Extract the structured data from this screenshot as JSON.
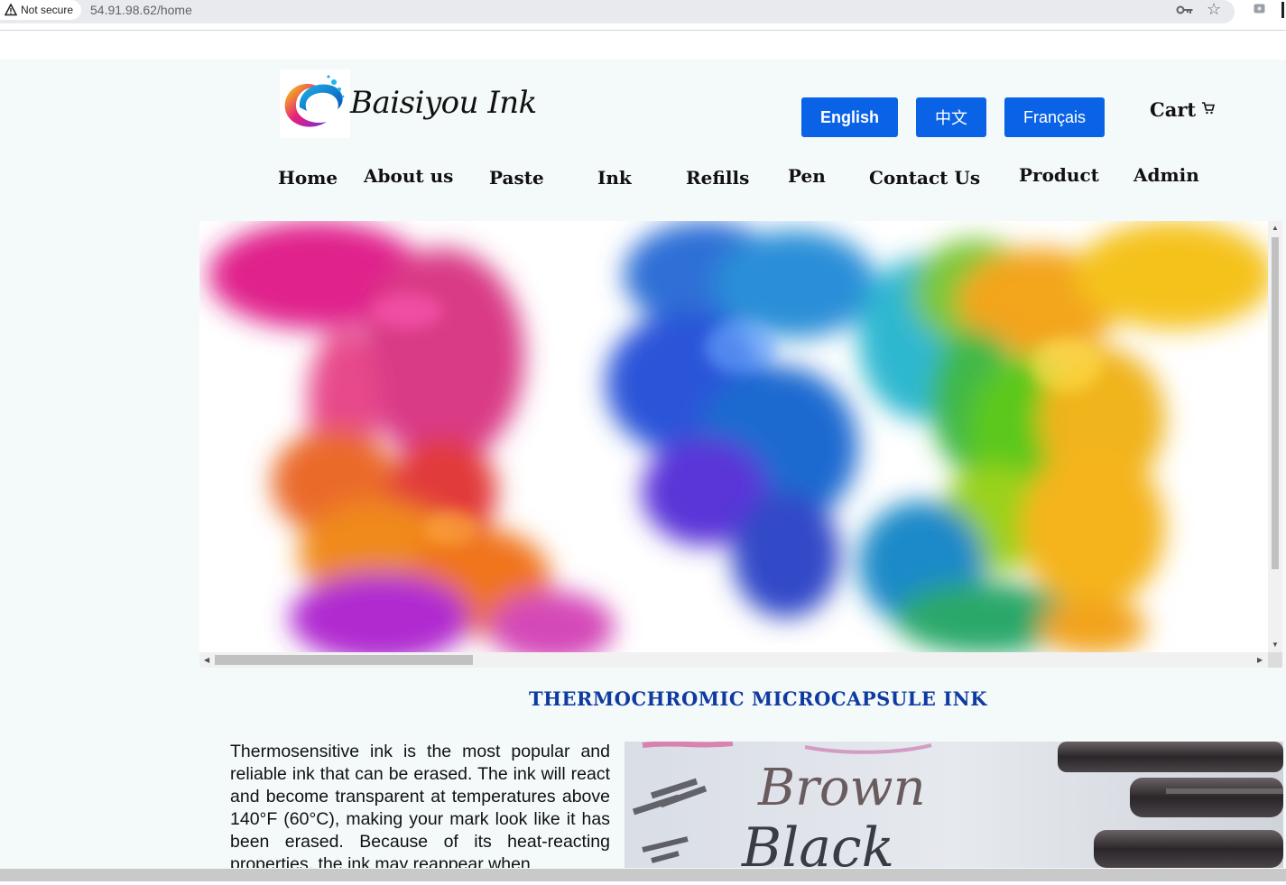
{
  "browser": {
    "security_label": "Not secure",
    "url": "54.91.98.62/home"
  },
  "header": {
    "brand": "Baisiyou Ink",
    "languages": [
      "English",
      "中文",
      "Français"
    ],
    "cart_label": "Cart"
  },
  "nav": {
    "items": [
      "Home",
      "About us",
      "Paste",
      "Ink",
      "Refills",
      "Pen",
      "Contact Us",
      "Product",
      "Admin"
    ]
  },
  "main": {
    "section_title": "THERMOCHROMIC MICROCAPSULE INK",
    "paragraph": "Thermosensitive ink is the most popular and reliable ink that can be erased. The ink will react and become transparent at temperatures above 140°F (60°C), making your mark look like it has been erased. Because of its heat-reacting properties, the ink may reappear when",
    "photo_words": [
      "Brown",
      "Black"
    ]
  },
  "colors": {
    "accent": "#0a63e6",
    "title": "#0f3aa1",
    "page_bg": "#f4faf9"
  },
  "icons": {
    "security": "warning-triangle-icon",
    "password": "key-icon",
    "bookmark": "star-icon",
    "cart": "cart-icon"
  }
}
